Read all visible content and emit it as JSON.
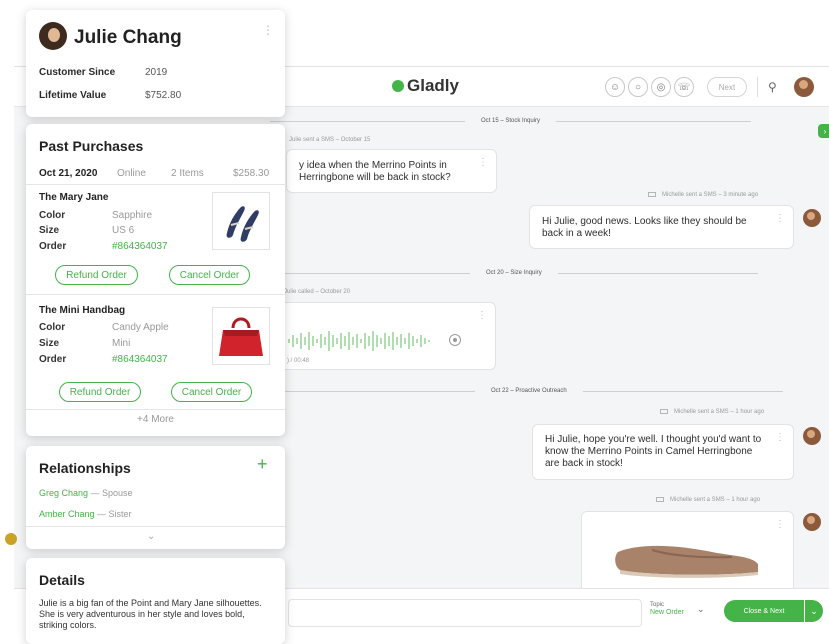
{
  "header": {
    "logo": "Gladly",
    "next_label": "Next"
  },
  "customer": {
    "name": "Julie Chang",
    "customer_since_label": "Customer Since",
    "customer_since": "2019",
    "lifetime_value_label": "Lifetime Value",
    "lifetime_value": "$752.80"
  },
  "purchases": {
    "title": "Past Purchases",
    "order": {
      "date": "Oct 21, 2020",
      "channel": "Online",
      "items": "2 Items",
      "total": "$258.30"
    },
    "color_label": "Color",
    "size_label": "Size",
    "order_label": "Order",
    "products": [
      {
        "name": "The Mary Jane",
        "color": "Sapphire",
        "size": "US 6",
        "order": "#864364037",
        "refund": "Refund Order",
        "cancel": "Cancel Order"
      },
      {
        "name": "The Mini Handbag",
        "color": "Candy Apple",
        "size": "Mini",
        "order": "#864364037",
        "refund": "Refund Order",
        "cancel": "Cancel Order"
      }
    ],
    "more": "+4 More"
  },
  "relationships": {
    "title": "Relationships",
    "items": [
      {
        "name": "Greg Chang",
        "rel": " — Spouse"
      },
      {
        "name": "Amber Chang",
        "rel": " — Sister"
      }
    ]
  },
  "details": {
    "title": "Details",
    "text": "Julie is a big fan of the Point and Mary Jane silhouettes. She is very adventurous in her style and loves bold, striking colors."
  },
  "conversation": {
    "dividers": [
      "Oct 15 – Stock Inquiry",
      "Oct 20 – Size Inquiry",
      "Oct 22 – Proactive Outreach"
    ],
    "messages": [
      {
        "meta": "Julie sent a SMS – October 15",
        "text": "y idea when the Merrino Points in Herringbone will be back in stock?"
      },
      {
        "meta": "Michelle sent a SMS – 3 minute ago",
        "text": "Hi Julie, good news. Looks like they should be back in a week!"
      },
      {
        "meta": "Julie called – October 20",
        "duration": ") / 00:48"
      },
      {
        "meta": "Michelle sent a SMS – 1 hour ago",
        "text": "Hi Julie, hope you're well. I thought you'd want to know the Merrino Points in Camel Herringbone are back in stock!"
      },
      {
        "meta": "Michelle sent a SMS – 1 hour ago"
      }
    ]
  },
  "composer": {
    "topic_label": "Topic",
    "topic_value": "New Order",
    "close_next": "Close & Next"
  },
  "colors": {
    "accent": "#44b449",
    "background": "#f4f5f6"
  }
}
